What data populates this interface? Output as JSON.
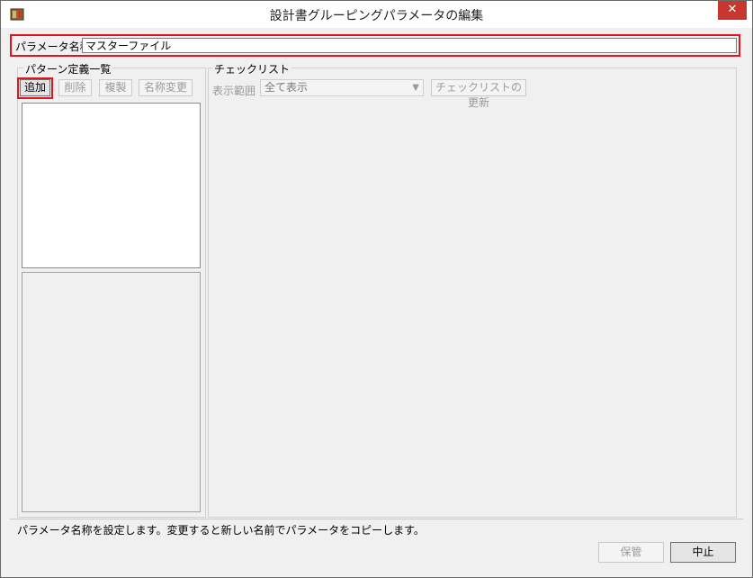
{
  "window": {
    "title": "設計書グルーピングパラメータの編集",
    "close_label": "✕"
  },
  "param": {
    "label": "パラメータ名称",
    "value": "マスターファイル"
  },
  "patterns": {
    "group_title": "パターン定義一覧",
    "add_label": "追加",
    "delete_label": "削除",
    "copy_label": "複製",
    "rename_label": "名称変更"
  },
  "checklist": {
    "group_title": "チェックリスト",
    "scope_label": "表示範囲",
    "scope_value": "全て表示",
    "refresh_label": "チェックリストの更新"
  },
  "status": {
    "message": "パラメータ名称を設定します。変更すると新しい名前でパラメータをコピーします。"
  },
  "footer": {
    "save_label": "保管",
    "cancel_label": "中止"
  },
  "icons": {
    "app": "app-icon",
    "close": "close-icon",
    "dropdown": "chevron-down-icon"
  }
}
